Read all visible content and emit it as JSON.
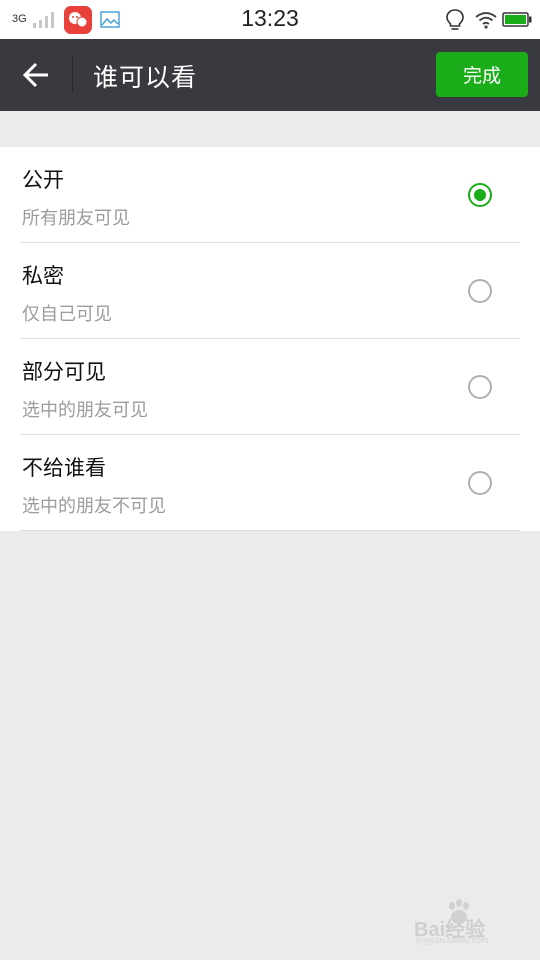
{
  "status_bar": {
    "network": "3G",
    "time": "13:23"
  },
  "header": {
    "title": "谁可以看",
    "done_label": "完成"
  },
  "options": [
    {
      "title": "公开",
      "subtitle": "所有朋友可见",
      "selected": true
    },
    {
      "title": "私密",
      "subtitle": "仅自己可见",
      "selected": false
    },
    {
      "title": "部分可见",
      "subtitle": "选中的朋友可见",
      "selected": false
    },
    {
      "title": "不给谁看",
      "subtitle": "选中的朋友不可见",
      "selected": false
    }
  ],
  "watermark": {
    "brand": "Bai经验",
    "sub": "jingyan.baidu.com"
  },
  "colors": {
    "accent": "#1aad19",
    "header_bg": "#393a3f",
    "page_bg": "#ebebeb"
  }
}
